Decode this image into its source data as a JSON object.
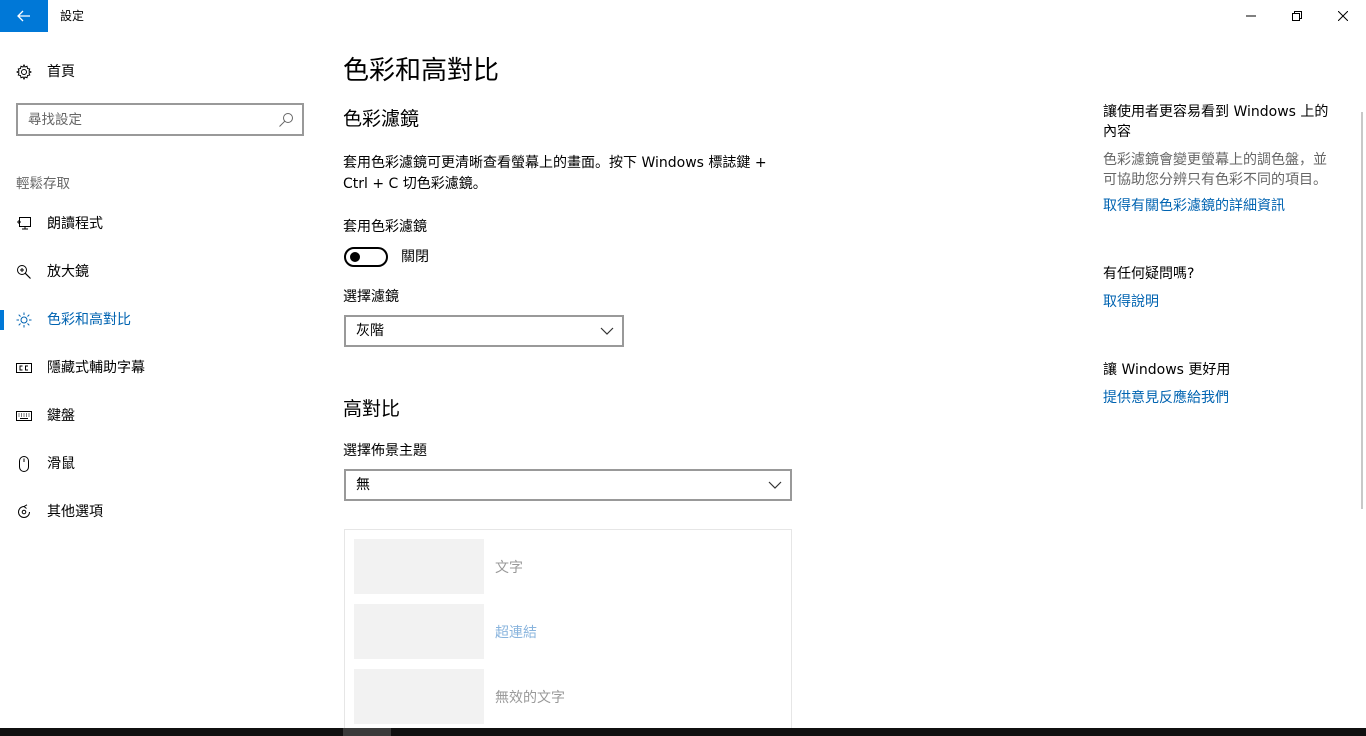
{
  "window": {
    "title": "設定",
    "minimize_icon": "minimize-icon",
    "maximize_icon": "restore-icon",
    "close_icon": "close-icon"
  },
  "colors": {
    "accent": "#0078d7",
    "link": "#0063b1"
  },
  "sidebar": {
    "home_label": "首頁",
    "search_placeholder": "尋找設定",
    "section_label": "輕鬆存取",
    "items": [
      {
        "label": "朗讀程式",
        "icon": "narrator-icon"
      },
      {
        "label": "放大鏡",
        "icon": "magnifier-icon"
      },
      {
        "label": "色彩和高對比",
        "icon": "brightness-icon",
        "selected": true
      },
      {
        "label": "隱藏式輔助字幕",
        "icon": "closed-captions-icon"
      },
      {
        "label": "鍵盤",
        "icon": "keyboard-icon"
      },
      {
        "label": "滑鼠",
        "icon": "mouse-icon"
      },
      {
        "label": "其他選項",
        "icon": "other-options-icon"
      }
    ]
  },
  "main": {
    "page_title": "色彩和高對比",
    "color_filters": {
      "heading": "色彩濾鏡",
      "description_line1": "套用色彩濾鏡可更清晰查看螢幕上的畫面。按下 Windows 標誌鍵 +",
      "description_line2": "Ctrl + C 切色彩濾鏡。",
      "toggle_label": "套用色彩濾鏡",
      "toggle_state": "關閉",
      "toggle_on": false,
      "select_label": "選擇濾鏡",
      "select_value": "灰階"
    },
    "high_contrast": {
      "heading": "高對比",
      "theme_label": "選擇佈景主題",
      "theme_value": "無",
      "preview": {
        "text_label": "文字",
        "link_label": "超連結",
        "disabled_label": "無效的文字"
      }
    }
  },
  "right_panel": {
    "section1": {
      "heading_line1": "讓使用者更容易看到 Windows 上的",
      "heading_line2": "內容",
      "text_line1": "色彩濾鏡會變更螢幕上的調色盤，並",
      "text_line2": "可協助您分辨只有色彩不同的項目。",
      "link": "取得有關色彩濾鏡的詳細資訊"
    },
    "section2": {
      "heading": "有任何疑問嗎?",
      "link": "取得說明"
    },
    "section3": {
      "heading": "讓 Windows 更好用",
      "link": "提供意見反應給我們"
    }
  }
}
